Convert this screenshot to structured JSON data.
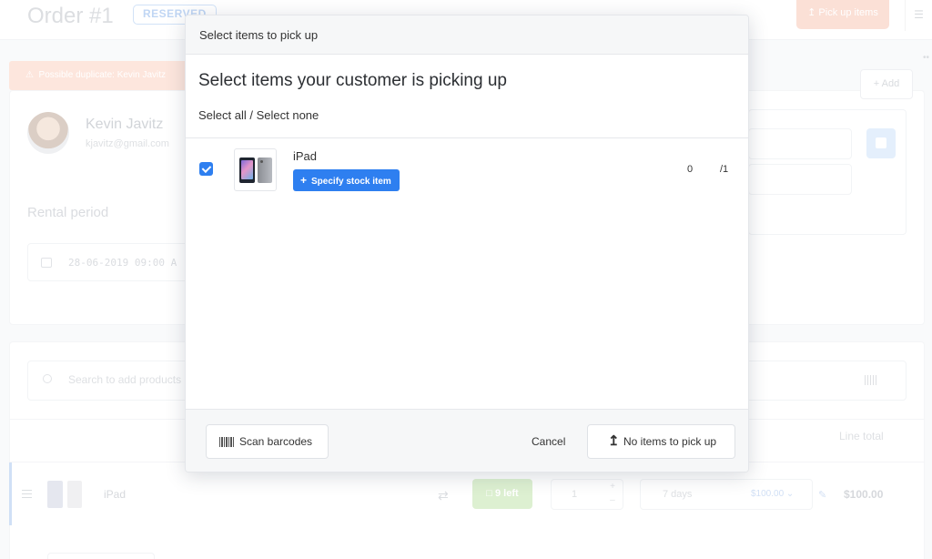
{
  "page": {
    "order_title": "Order #1",
    "status_badge": "RESERVED",
    "pickup_button": "Pick up items",
    "duplicate_warning": "Possible duplicate: Kevin Javitz",
    "add_button": "Add",
    "customer": {
      "name": "Kevin Javitz",
      "email": "kjavitz@gmail.com"
    },
    "rental_period_label": "Rental period",
    "rental_start": "28-06-2019 09:00 A",
    "search_placeholder": "Search to add products",
    "line_total_header": "Line total",
    "line": {
      "product_name": "iPad",
      "stock_badge": "9 left",
      "quantity": "1",
      "duration": "7 days",
      "price": "$100.00",
      "line_total": "$100.00"
    }
  },
  "modal": {
    "header_title": "Select items to pick up",
    "heading": "Select items your customer is picking up",
    "select_all": "Select all",
    "separator": " / ",
    "select_none": "Select none",
    "items": [
      {
        "name": "iPad",
        "checked": true,
        "specify_button": "Specify stock item",
        "picked": "0",
        "total": "/1"
      }
    ],
    "footer": {
      "scan_button": "Scan barcodes",
      "cancel_button": "Cancel",
      "no_items_button": "No items to pick up"
    }
  },
  "colors": {
    "primary_blue": "#2e7ff0",
    "warning_bg": "#fcd9cb",
    "stock_green": "#cbe8b9"
  }
}
